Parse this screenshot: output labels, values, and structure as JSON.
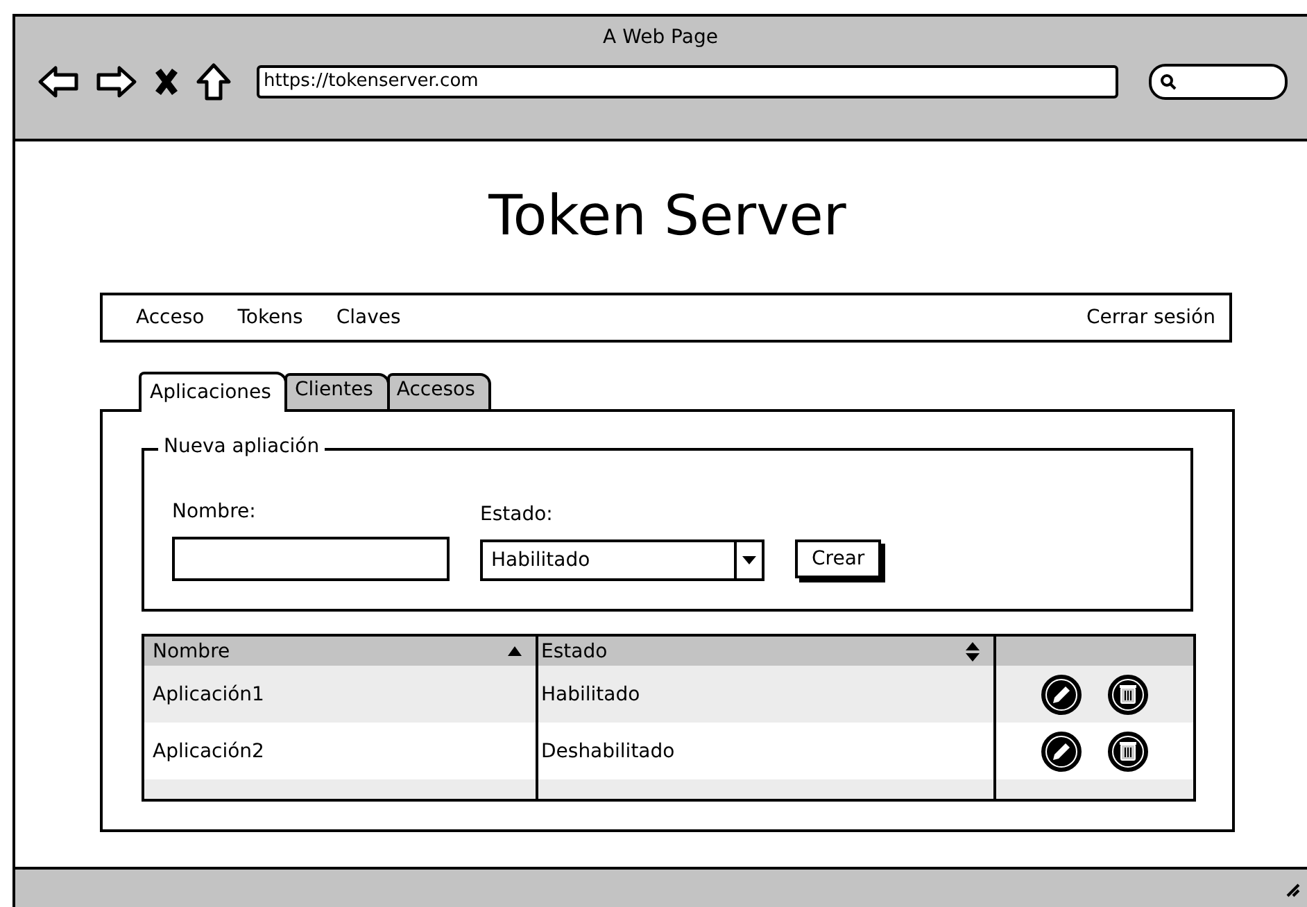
{
  "window": {
    "title": "A Web Page",
    "url": "https://tokenserver.com"
  },
  "page_title": "Token Server",
  "nav": {
    "items": [
      "Acceso",
      "Tokens",
      "Claves"
    ],
    "logout": "Cerrar sesión"
  },
  "tabs": [
    {
      "label": "Aplicaciones",
      "selected": true
    },
    {
      "label": "Clientes",
      "selected": false
    },
    {
      "label": "Accesos",
      "selected": false
    }
  ],
  "form": {
    "legend": "Nueva apliación",
    "name_label": "Nombre:",
    "state_label": "Estado:",
    "state_value": "Habilitado",
    "submit": "Crear"
  },
  "table": {
    "columns": [
      {
        "label": "Nombre",
        "sorted": true
      },
      {
        "label": "Estado",
        "sorted": false
      }
    ],
    "rows": [
      {
        "name": "Aplicación1",
        "state": "Habilitado"
      },
      {
        "name": "Aplicación2",
        "state": "Deshabilitado"
      }
    ]
  }
}
